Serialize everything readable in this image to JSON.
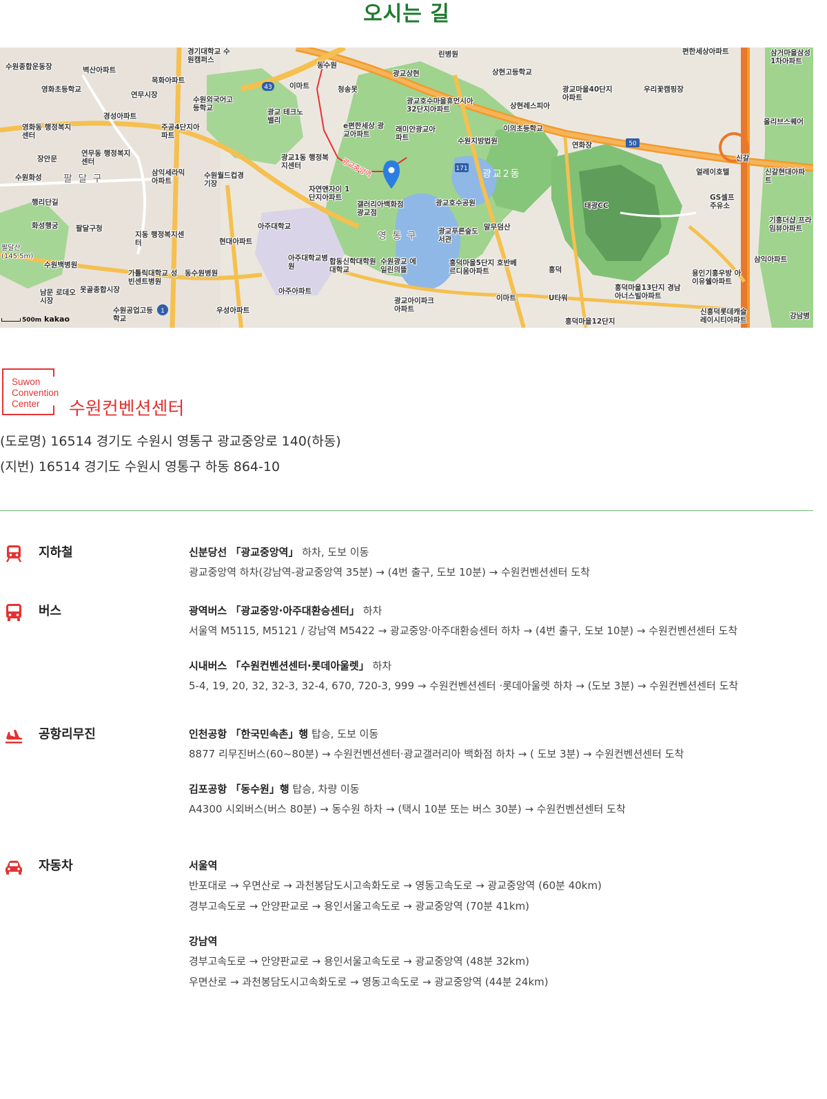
{
  "page": {
    "title": "오시는 길"
  },
  "map": {
    "scale_label": "500m",
    "brand": "kakao",
    "district_labels": [
      "팔 달 구",
      "영 통 구",
      "광교2동"
    ],
    "labels": [
      "수원종합운동장",
      "벽산아파트",
      "영화초등학교",
      "목화아파트",
      "연무시장",
      "경성아파트",
      "영화동 행정복지센터",
      "연무동 행정복지센터",
      "장안문",
      "수원화성",
      "행리단길",
      "화성행궁",
      "팔달구청",
      "팔달산 (145.5m)",
      "수원백병원",
      "남문 로데오시장",
      "못골종합시장",
      "가톨릭대학교 성빈센트병원",
      "동수원병원",
      "수원공업고등학교",
      "지동 행정복지센터",
      "현대아파트",
      "아주대학교",
      "아주대학교병원",
      "아주아파트",
      "우성아파트",
      "삼익세라믹 아파트",
      "수원월드컵경기장",
      "주공4단지아파트",
      "수원외국어고등학교",
      "광교 테크노밸리",
      "경기대학교 수원캠퍼스",
      "이마트",
      "청송못",
      "동수원",
      "광교1동 행정복지센터",
      "자연앤자이 1단지아파트",
      "e편한세상 광교아파트",
      "래미안광교아파트",
      "갤러리아백화점 광교점",
      "합동신학대학원대학교",
      "수원광교 에일린의뜰",
      "광교호수공원",
      "광교아이파크아파트",
      "광교푸른숲도서관",
      "흥덕마을5단지 호반베르디움아파트",
      "이마트",
      "U타워",
      "흥덕",
      "흥덕마을12단지",
      "흥덕마을13단지 경남아너스빌아파트",
      "광교호수마을휴먼시아 32단지아파트",
      "광교상현",
      "린병원",
      "상현고등학교",
      "수원지방법원",
      "이의초등학교",
      "광교마을40단지아파트",
      "상현레스피아",
      "연화장",
      "우리꽃캠핑장",
      "편한세상아파트",
      "태광CC",
      "얼레이호텔",
      "GS셀프 주유소",
      "신갈",
      "신갈현대아파트",
      "기흥더샵 프라임뷰아파트",
      "삼익아파트",
      "용인기흥우방 아이유쉘아파트",
      "신흥덕롯데캐슬 레이시티아파트",
      "삼거마을삼성 1차아파트",
      "올리브스퀘어",
      "강남병",
      "말무덤산",
      "광교중앙역"
    ],
    "road_badges": [
      "43",
      "171",
      "50",
      "1"
    ]
  },
  "venue": {
    "logo_lines": [
      "Suwon",
      "Convention",
      "Center"
    ],
    "name": "수원컨벤션센터",
    "address_road": "(도로명) 16514 경기도 수원시 영통구 광교중앙로 140(하동)",
    "address_lot": "(지번) 16514 경기도 수원시 영통구 하동 864-10"
  },
  "transport": [
    {
      "icon": "subway-icon",
      "title": "지하철",
      "routes": [
        {
          "head_bold": "신분당선 「광교중앙역」",
          "head_rest": "하차, 도보 이동",
          "lines": [
            "광교중앙역 하차(강남역-광교중앙역 35분) → (4번 출구, 도보 10분) → 수원컨벤션센터 도착"
          ]
        }
      ]
    },
    {
      "icon": "bus-icon",
      "title": "버스",
      "routes": [
        {
          "head_bold": "광역버스 「광교중앙·아주대환승센터」",
          "head_rest": "하차",
          "lines": [
            "서울역 M5115, M5121 / 강남역 M5422 → 광교중앙·아주대환승센터 하차 → (4번 출구, 도보 10분) → 수원컨벤션센터 도착"
          ]
        },
        {
          "head_bold": "시내버스 「수원컨벤션센터·롯데아울렛」",
          "head_rest": "하차",
          "lines": [
            "5-4, 19, 20, 32, 32-3, 32-4, 670, 720-3, 999 → 수원컨벤션센터 ·롯데아울렛 하차 → (도보 3분) → 수원컨벤션센터 도착"
          ]
        }
      ]
    },
    {
      "icon": "airplane-icon",
      "title": "공항리무진",
      "routes": [
        {
          "head_bold": "인천공항 「한국민속촌」행",
          "head_rest": "탑승, 도보 이동",
          "lines": [
            "8877 리무진버스(60~80분) → 수원컨벤션센터·광교갤러리아 백화점 하차 → ( 도보 3분) → 수원컨벤션센터 도착"
          ]
        },
        {
          "head_bold": "김포공항 「동수원」행",
          "head_rest": "탑승, 차량 이동",
          "lines": [
            "A4300 시외버스(버스 80분) → 동수원 하차 → (택시 10분 또는 버스 30분) → 수원컨벤션센터 도착"
          ]
        }
      ]
    },
    {
      "icon": "car-icon",
      "title": "자동차",
      "routes": [
        {
          "head_bold": "서울역",
          "head_rest": "",
          "lines": [
            "반포대로 → 우면산로 → 과천봉담도시고속화도로 → 영동고속도로 → 광교중앙역 (60분 40km)",
            "경부고속도로 → 안양판교로 → 용인서울고속도로 → 광교중앙역 (70분 41km)"
          ]
        },
        {
          "head_bold": "강남역",
          "head_rest": "",
          "lines": [
            "경부고속도로 → 안양판교로 → 용인서울고속도로 → 광교중앙역 (48분 32km)",
            "우면산로 → 과천봉담도시고속화도로 → 영동고속도로 → 광교중앙역 (44분 24km)"
          ]
        }
      ]
    }
  ],
  "colors": {
    "title_green": "#1e7a2e",
    "brand_red": "#e53232",
    "divider_green": "#6fbf6f"
  }
}
